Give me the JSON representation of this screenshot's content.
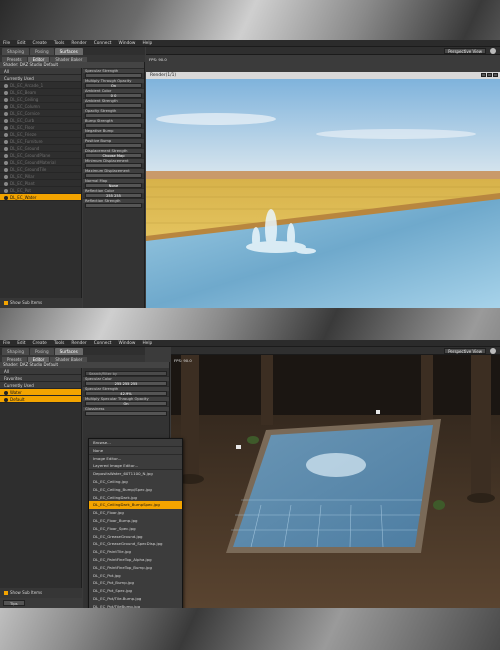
{
  "menu": [
    "File",
    "Edit",
    "Create",
    "Tools",
    "Render",
    "Connect",
    "Window",
    "Help"
  ],
  "shot1": {
    "tabs": [
      "Shaping",
      "Posing",
      "Surfaces"
    ],
    "subtabs": [
      "Presets",
      "Editor",
      "Shader Baker"
    ],
    "panel_title": "Shader: DAZ Studio Default",
    "tree": [
      {
        "label": "All",
        "style": "hdr"
      },
      {
        "label": "Currently Used",
        "style": "hdr"
      },
      {
        "label": "DL_EC_Arcade_1",
        "style": "dim"
      },
      {
        "label": "DL_EC_Beam",
        "style": "dim"
      },
      {
        "label": "DL_EC_Ceiling",
        "style": "dim"
      },
      {
        "label": "DL_EC_Column",
        "style": "dim"
      },
      {
        "label": "DL_EC_Cornice",
        "style": "dim"
      },
      {
        "label": "DL_EC_Curb",
        "style": "dim"
      },
      {
        "label": "DL_EC_Floor",
        "style": "dim"
      },
      {
        "label": "DL_EC_Frieze",
        "style": "dim"
      },
      {
        "label": "DL_EC_Furniture",
        "style": "dim"
      },
      {
        "label": "DL_EC_Ground",
        "style": "dim"
      },
      {
        "label": "DL_EC_GroundPlane",
        "style": "dim"
      },
      {
        "label": "DL_EC_GroundMaterial",
        "style": "dim"
      },
      {
        "label": "DL_EC_GroundTile",
        "style": "dim"
      },
      {
        "label": "DL_EC_Pillar",
        "style": "dim"
      },
      {
        "label": "DL_EC_Plant",
        "style": "dim"
      },
      {
        "label": "DL_EC_Pot",
        "style": "dim"
      },
      {
        "label": "DL_EC_Water",
        "style": "sel"
      }
    ],
    "show_sub": "Show Sub Items",
    "props": [
      {
        "label": "Specular Strength",
        "value": ""
      },
      {
        "label": "Multiply Through Opacity",
        "value": "On"
      },
      {
        "label": "Ambient Color",
        "value": "0     0"
      },
      {
        "label": "Ambient Strength",
        "value": ""
      },
      {
        "label": "Opacity Strength",
        "value": ""
      },
      {
        "label": "Bump Strength",
        "value": ""
      },
      {
        "label": "Negative Bump",
        "value": ""
      },
      {
        "label": "Positive Bump",
        "value": ""
      },
      {
        "label": "Displacement Strength",
        "value": "Choose Map"
      },
      {
        "label": "Minimum Displacement",
        "value": ""
      },
      {
        "label": "Maximum Displacement",
        "value": ""
      },
      {
        "label": "Normal Map",
        "value": "None"
      },
      {
        "label": "Reflection Color",
        "value": "255     255"
      },
      {
        "label": "Reflection Strength",
        "value": ""
      }
    ],
    "viewport_label": "Perspective View",
    "fps": "FPS: 90.0",
    "render_title": "Render(1/1)"
  },
  "shot2": {
    "tabs": [
      "Shaping",
      "Posing",
      "Surfaces"
    ],
    "subtabs": [
      "Presets",
      "Editor",
      "Shader Baker"
    ],
    "panel_title": "Shader: DAZ Studio Default",
    "tree": [
      {
        "label": "All",
        "style": "hdr"
      },
      {
        "label": "Favorites",
        "style": "hdr"
      },
      {
        "label": "Currently Used",
        "style": "hdr"
      },
      {
        "label": "Water",
        "style": "sel"
      },
      {
        "label": "Default",
        "style": "sel"
      }
    ],
    "show_sub": "Show Sub Items",
    "tips": "Tips",
    "props_search": "Search/Filter by",
    "props": [
      {
        "label": "Specular Color",
        "value": "255     255     255"
      },
      {
        "label": "Specular Strength",
        "value": "42.9%"
      },
      {
        "label": "Multiply Specular Through Opacity",
        "value": "On"
      },
      {
        "label": "Glossiness",
        "value": ""
      }
    ],
    "viewport_label": "Perspective View",
    "fps": "FPS: 90.0",
    "dropdown": [
      {
        "label": "Browse...",
        "style": "sep"
      },
      {
        "label": "None",
        "style": "sep"
      },
      {
        "label": "Image Editor...",
        "style": ""
      },
      {
        "label": "Layered Image Editor...",
        "style": "sep"
      },
      {
        "label": "DepositsWater_60T1100_N.jpg",
        "style": ""
      },
      {
        "label": "DL_EC_Ceiling.jpg",
        "style": ""
      },
      {
        "label": "DL_EC_Ceiling_Bump/Spec.jpg",
        "style": ""
      },
      {
        "label": "DL_EC_CeilingDark.jpg",
        "style": ""
      },
      {
        "label": "DL_EC_CeilingDark_BumpSpec.jpg",
        "style": "sel"
      },
      {
        "label": "DL_EC_Floor.jpg",
        "style": ""
      },
      {
        "label": "DL_EC_Floor_Bump.jpg",
        "style": ""
      },
      {
        "label": "DL_EC_Floor_Spec.jpg",
        "style": ""
      },
      {
        "label": "DL_EC_GreaseGround.jpg",
        "style": ""
      },
      {
        "label": "DL_EC_GreaseGround_SpecDisp.jpg",
        "style": ""
      },
      {
        "label": "DL_EC_PaintTile.jpg",
        "style": ""
      },
      {
        "label": "DL_EC_PaintFineTop_Alpha.jpg",
        "style": ""
      },
      {
        "label": "DL_EC_PaintFineTop_Bump.jpg",
        "style": ""
      },
      {
        "label": "DL_EC_Pot.jpg",
        "style": ""
      },
      {
        "label": "DL_EC_Pot_Bump.jpg",
        "style": ""
      },
      {
        "label": "DL_EC_Pot_Spec.jpg",
        "style": ""
      },
      {
        "label": "DL_EC_Pot/Tile-Bump.jpg",
        "style": ""
      },
      {
        "label": "DL_EC_Pot/TileBump.jpg",
        "style": ""
      }
    ]
  },
  "colors": {
    "accent": "#f3a400",
    "water": "#7fb6d8",
    "sand": "#e9c24b",
    "sky": "#9fc6e6"
  }
}
